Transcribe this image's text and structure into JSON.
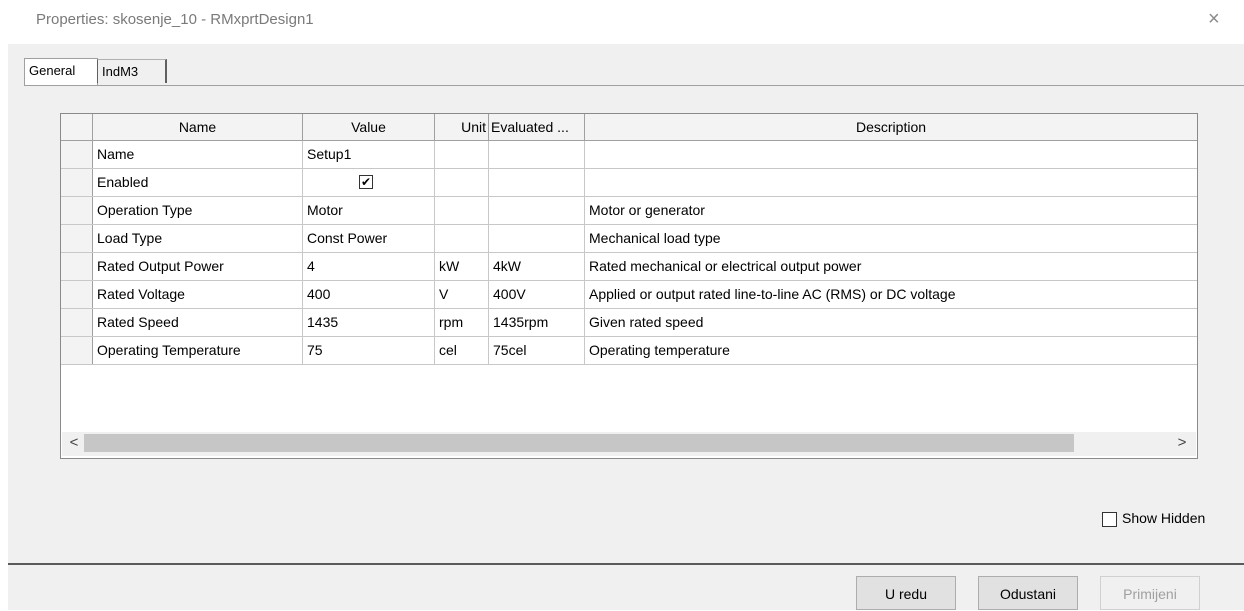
{
  "window": {
    "title": "Properties: skosenje_10 - RMxprtDesign1",
    "close_glyph": "×"
  },
  "tabs": [
    {
      "label": "General",
      "active": true
    },
    {
      "label": "IndM3",
      "active": false
    }
  ],
  "grid": {
    "columns": [
      "Name",
      "Value",
      "Unit",
      "Evaluated ...",
      "Description"
    ],
    "rows": [
      {
        "name": "Name",
        "value": "Setup1",
        "unit": "",
        "evaluated": "",
        "description": ""
      },
      {
        "name": "Enabled",
        "value": "",
        "unit": "",
        "evaluated": "",
        "description": "",
        "checkbox": true,
        "checked": true
      },
      {
        "name": "Operation Type",
        "value": "Motor",
        "unit": "",
        "evaluated": "",
        "description": "Motor or generator"
      },
      {
        "name": "Load Type",
        "value": "Const Power",
        "unit": "",
        "evaluated": "",
        "description": "Mechanical load type"
      },
      {
        "name": "Rated Output Power",
        "value": "4",
        "unit": "kW",
        "evaluated": "4kW",
        "description": "Rated mechanical or electrical output power"
      },
      {
        "name": "Rated Voltage",
        "value": "400",
        "unit": "V",
        "evaluated": "400V",
        "description": "Applied or output rated line-to-line AC (RMS) or DC voltage"
      },
      {
        "name": "Rated Speed",
        "value": "1435",
        "unit": "rpm",
        "evaluated": "1435rpm",
        "description": "Given rated speed"
      },
      {
        "name": "Operating Temperature",
        "value": "75",
        "unit": "cel",
        "evaluated": "75cel",
        "description": "Operating temperature"
      }
    ],
    "checkmark_glyph": "✔",
    "scroll_left_glyph": "<",
    "scroll_right_glyph": ">"
  },
  "show_hidden": {
    "label": "Show Hidden",
    "checked": false
  },
  "buttons": {
    "ok": "U redu",
    "cancel": "Odustani",
    "apply": "Primijeni"
  }
}
